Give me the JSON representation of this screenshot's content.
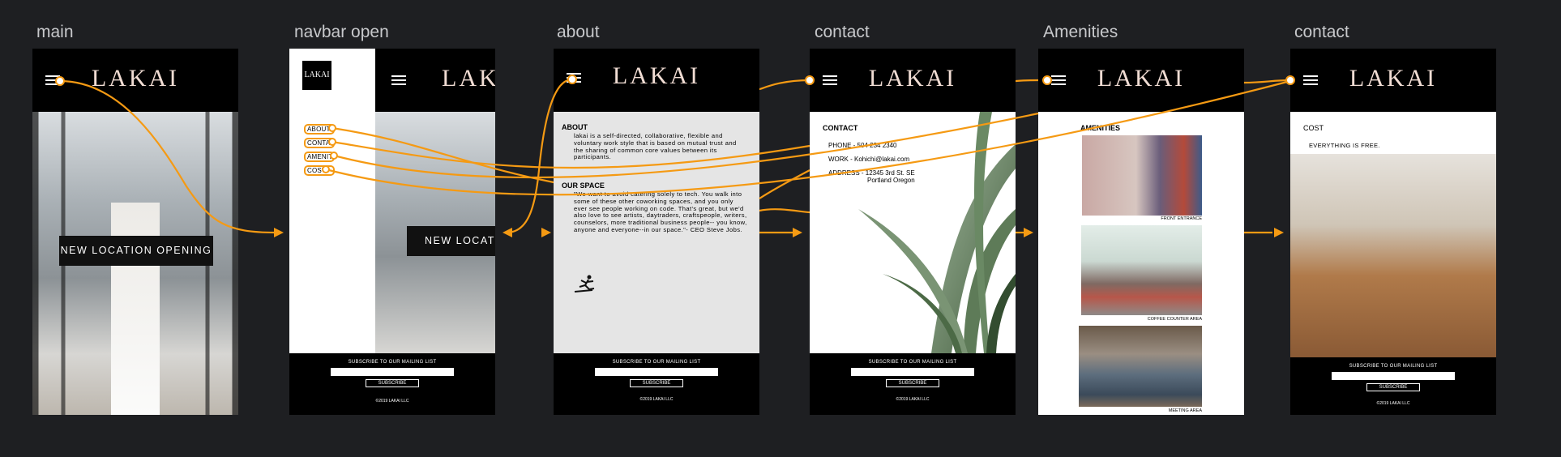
{
  "frames": [
    {
      "title": "main"
    },
    {
      "title": "navbar open"
    },
    {
      "title": "about"
    },
    {
      "title": "contact"
    },
    {
      "title": "Amenities"
    },
    {
      "title": "contact"
    }
  ],
  "brand": {
    "logo": "LAKAI",
    "logo_small": "LAKAI",
    "logo_partial": "LAK"
  },
  "main": {
    "banner": "NEW LOCATION OPENING"
  },
  "navbar": {
    "items": [
      "ABOUT",
      "CONTACT",
      "AMENITIES",
      "COST"
    ],
    "banner": "NEW LOCAT"
  },
  "about": {
    "about_title": "ABOUT",
    "about_text": "lakai is a self-directed, collaborative, flexible and voluntary work style that is based on mutual trust and the sharing of common core values between its participants.",
    "space_title": "OUR SPACE",
    "space_text": "\"We want to avoid catering solely to tech. You walk into some of these other coworking spaces, and you only ever see people working on code. That's great, but we'd also love to see artists, daytraders, craftspeople, writers, counselors, more traditional business people-- you know, anyone and everyone--in our space.\"- CEO Steve Jobs."
  },
  "contact": {
    "title": "CONTACT",
    "phone": "PHONE - 504 234 2340",
    "work": "WORK - Kohichi@lakai.com",
    "address_1": "ADDRESS - 12345 3rd St. SE",
    "address_2": "Portland Oregon"
  },
  "amenities": {
    "title": "AMENITIES",
    "captions": [
      "FRONT ENTRANCE",
      "COFFEE COUNTER AREA",
      "MEETING AREA"
    ]
  },
  "cost": {
    "title": "COST",
    "text": "EVERYTHING IS FREE."
  },
  "footer": {
    "subscribe_label": "SUBSCRIBE TO OUR MAILING LIST",
    "subscribe_button": "SUBSCRIBE",
    "copyright": "©2019 LAKAI LLC"
  },
  "colors": {
    "canvas": "#1e1f22",
    "flow_arrow": "#f59a13",
    "logo": "#f1ddd4"
  }
}
